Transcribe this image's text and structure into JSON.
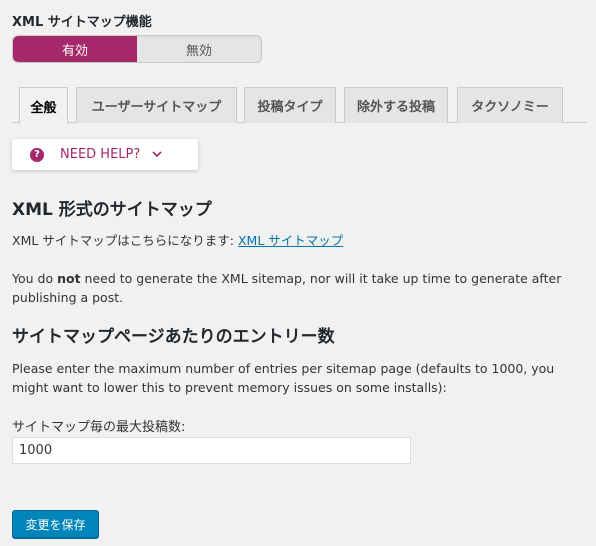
{
  "sitemap_feature": {
    "label": "XML サイトマップ機能",
    "on_label": "有効",
    "off_label": "無効"
  },
  "tabs": [
    {
      "label": "全般",
      "active": true
    },
    {
      "label": "ユーザーサイトマップ",
      "active": false
    },
    {
      "label": "投稿タイプ",
      "active": false
    },
    {
      "label": "除外する投稿",
      "active": false
    },
    {
      "label": "タクソノミー",
      "active": false
    }
  ],
  "help": {
    "icon": "question-circle-icon",
    "label": "NEED HELP?",
    "chevron": "chevron-down-icon"
  },
  "xml_section": {
    "heading": "XML 形式のサイトマップ",
    "intro_text": "XML サイトマップはこちらになります: ",
    "link_text": "XML サイトマップ",
    "note_before": "You do ",
    "note_bold": "not",
    "note_after": " need to generate the XML sitemap, nor will it take up time to generate after publishing a post."
  },
  "entries_section": {
    "heading": "サイトマップページあたりのエントリー数",
    "description": "Please enter the maximum number of entries per sitemap page (defaults to 1000, you might want to lower this to prevent memory issues on some installs):",
    "field_label": "サイトマップ毎の最大投稿数:",
    "field_value": "1000"
  },
  "save_button": {
    "label": "変更を保存"
  },
  "colors": {
    "accent": "#a4286a",
    "link": "#0073aa",
    "primary_button": "#0085ba",
    "background": "#f1f1f1"
  }
}
